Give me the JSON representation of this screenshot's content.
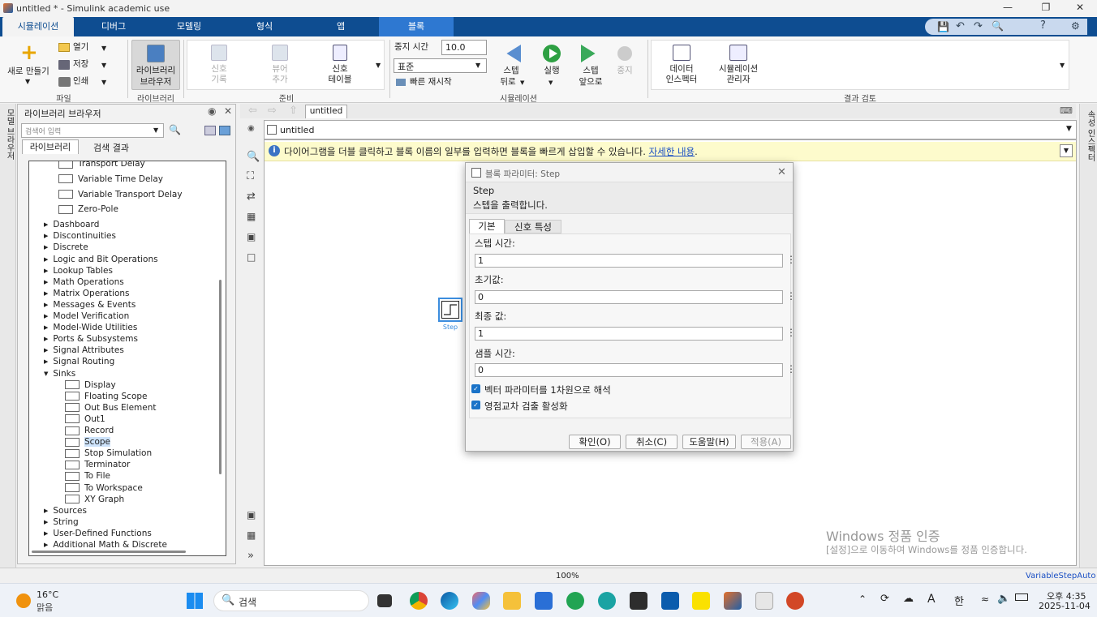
{
  "window": {
    "title": "untitled * - Simulink academic use"
  },
  "tabs": [
    "시뮬레이션",
    "디버그",
    "모델링",
    "형식",
    "앱",
    "블록"
  ],
  "ribbon": {
    "file": {
      "new": "새로 만들기",
      "open": "열기",
      "save": "저장",
      "print": "인쇄",
      "group": "파일"
    },
    "library": {
      "btn1": "라이브러리",
      "btn2": "브라우저",
      "group": "라이브러리"
    },
    "prepare": {
      "sig1": "신호",
      "sig2": "기록",
      "view1": "뷰어",
      "view2": "추가",
      "tbl1": "신호",
      "tbl2": "테이블",
      "group": "준비"
    },
    "sim": {
      "stop_label": "중지 시간",
      "stop_value": "10.0",
      "mode": "표준",
      "fast": "빠른 재시작",
      "back1": "스텝",
      "back2": "뒤로",
      "run": "실행",
      "fwd1": "스텝",
      "fwd2": "앞으로",
      "stop": "중지",
      "group": "시뮬레이션"
    },
    "review": {
      "di1": "데이터",
      "di2": "인스펙터",
      "sm1": "시뮬레이션",
      "sm2": "관리자",
      "group": "결과 검토"
    }
  },
  "library": {
    "title": "라이브러리 브라우저",
    "search_placeholder": "검색어 입력",
    "tab_lib": "라이브러리",
    "tab_results": "검색 결과",
    "left_strip": "모델 브라우저",
    "tree": {
      "top_blocks": [
        "Transport Delay",
        "Variable Time Delay",
        "Variable Transport Delay",
        "Zero-Pole"
      ],
      "categories": [
        "Dashboard",
        "Discontinuities",
        "Discrete",
        "Logic and Bit Operations",
        "Lookup Tables",
        "Math Operations",
        "Matrix Operations",
        "Messages & Events",
        "Model Verification",
        "Model-Wide Utilities",
        "Ports & Subsystems",
        "Signal Attributes",
        "Signal Routing"
      ],
      "open_category": "Sinks",
      "sinks": [
        "Display",
        "Floating Scope",
        "Out Bus Element",
        "Out1",
        "Record",
        "Scope",
        "Stop Simulation",
        "Terminator",
        "To File",
        "To Workspace",
        "XY Graph"
      ],
      "bottom_categories": [
        "Sources",
        "String",
        "User-Defined Functions",
        "Additional Math & Discrete"
      ]
    }
  },
  "canvas": {
    "tab": "untitled",
    "breadcrumb": "untitled",
    "info": "다이어그램을 더블 클릭하고 블록 이름의 일부를 입력하면 블록을 빠르게 삽입할 수 있습니다.",
    "info_link": "자세한 내용",
    "info_period": ".",
    "block_label": "Step",
    "watermark_title": "Windows 정품 인증",
    "watermark_sub": "[설정]으로 이동하여 Windows를 정품 인증합니다.",
    "right_strip": "속성 인스펙터"
  },
  "dialog": {
    "title": "블록 파라미터: Step",
    "block_name": "Step",
    "desc": "스텝을 출력합니다.",
    "tab_main": "기본",
    "tab_signal": "신호 특성",
    "fields": [
      {
        "label": "스텝 시간:",
        "value": "1"
      },
      {
        "label": "초기값:",
        "value": "0"
      },
      {
        "label": "최종 값:",
        "value": "1"
      },
      {
        "label": "샘플 시간:",
        "value": "0"
      }
    ],
    "check1": "벡터 파라미터를 1차원으로 해석",
    "check2": "영점교차 검출 활성화",
    "ok": "확인(O)",
    "cancel": "취소(C)",
    "help": "도움말(H)",
    "apply": "적용(A)"
  },
  "status": {
    "zoom": "100%",
    "solver": "VariableStepAuto"
  },
  "taskbar": {
    "temp": "16°C",
    "weather": "맑음",
    "search": "검색",
    "time": "오후 4:35",
    "date": "2025-11-04",
    "ime_a": "A",
    "ime_han": "한"
  }
}
